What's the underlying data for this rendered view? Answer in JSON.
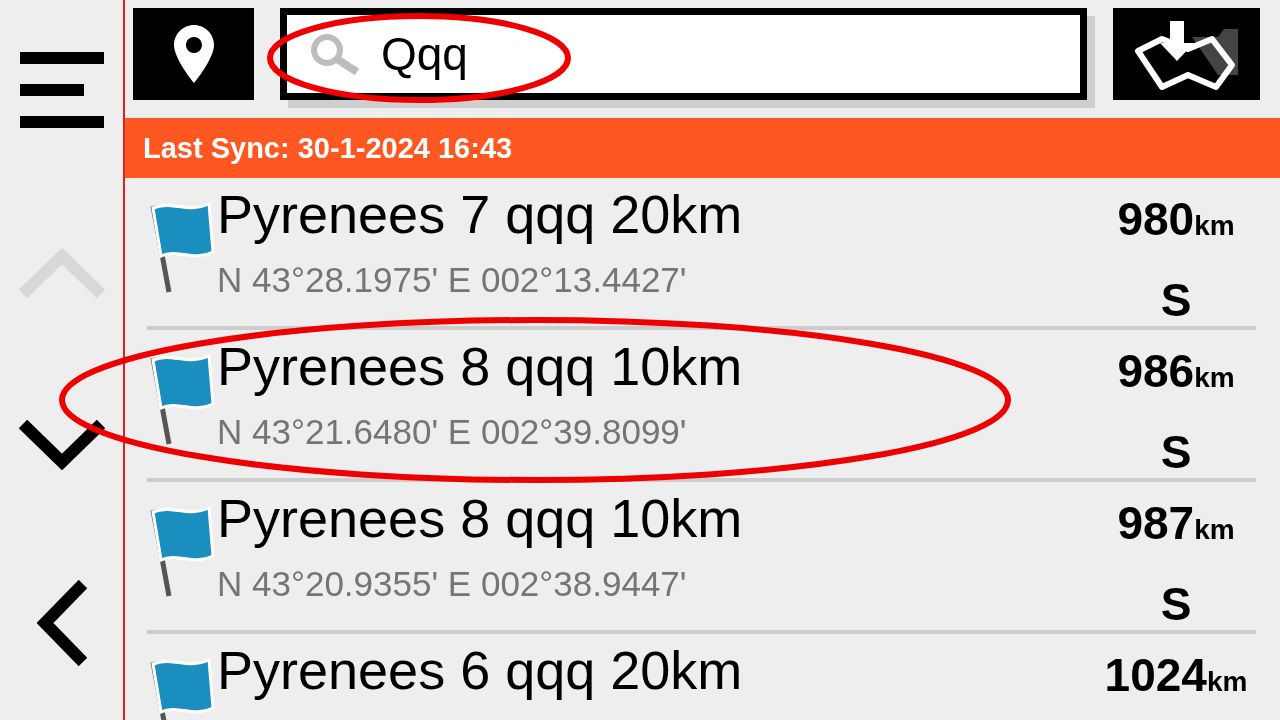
{
  "sidebar": {
    "items": [
      {
        "kind": "menu",
        "disabled": false
      },
      {
        "kind": "up",
        "disabled": true
      },
      {
        "kind": "down",
        "disabled": false
      },
      {
        "kind": "back",
        "disabled": false
      }
    ]
  },
  "search": {
    "value": "Qqq"
  },
  "sync_banner": "Last Sync: 30-1-2024 16:43",
  "waypoints": [
    {
      "name": "Pyrenees 7 qqq 20km",
      "coordinates": "N 43°28.1975' E 002°13.4427'",
      "distance": "980",
      "unit": "km",
      "direction": "S"
    },
    {
      "name": "Pyrenees 8 qqq 10km",
      "coordinates": "N 43°21.6480' E 002°39.8099'",
      "distance": "986",
      "unit": "km",
      "direction": "S"
    },
    {
      "name": "Pyrenees 8 qqq 10km",
      "coordinates": "N 43°20.9355' E 002°38.9447'",
      "distance": "987",
      "unit": "km",
      "direction": "S"
    },
    {
      "name": "Pyrenees 6 qqq 20km",
      "distance": "1024",
      "unit": "km"
    }
  ]
}
